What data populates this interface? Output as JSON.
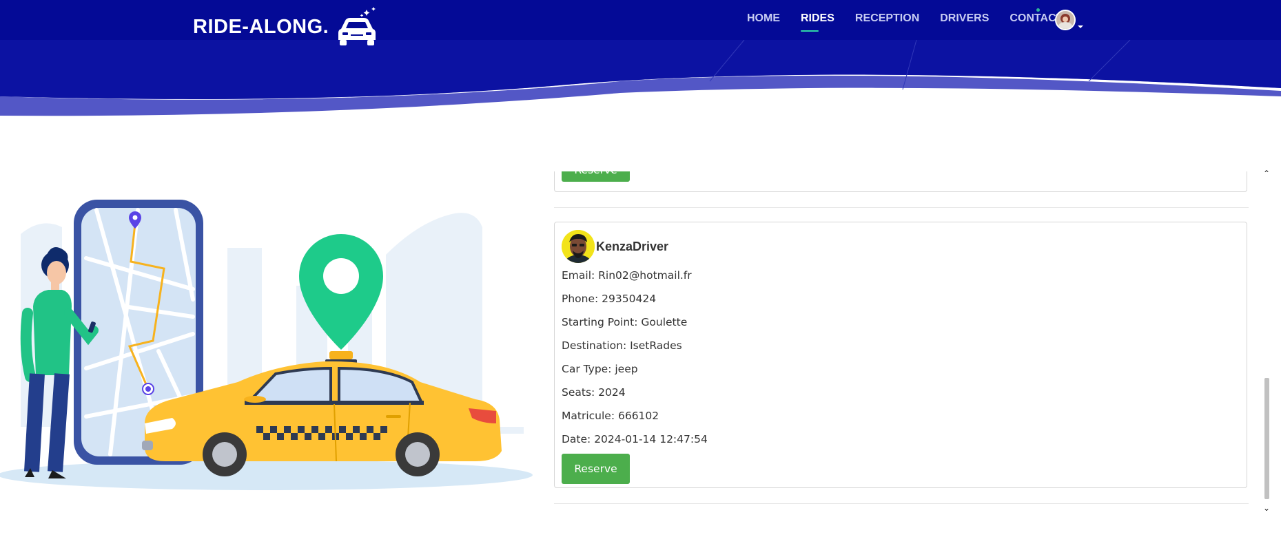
{
  "header": {
    "brand": "RIDE-ALONG.",
    "nav": [
      {
        "label": "HOME",
        "active": false
      },
      {
        "label": "RIDES",
        "active": true
      },
      {
        "label": "RECEPTION",
        "active": false
      },
      {
        "label": "DRIVERS",
        "active": false
      },
      {
        "label": "CONTACT",
        "active": false
      }
    ]
  },
  "colors": {
    "header_bg": "#040a96",
    "accent": "#2fd7a8",
    "reserve_button": "#4cae4c",
    "pin_green": "#1ecb8a",
    "taxi_yellow": "#ffc233"
  },
  "rides": {
    "previous_card": {
      "reserve_label": "Reserve"
    },
    "card": {
      "driver_name": "KenzaDriver",
      "email": "Email: Rin02@hotmail.fr",
      "phone": "Phone: 29350424",
      "starting_point": "Starting Point: Goulette",
      "destination": "Destination: IsetRades",
      "car_type": "Car Type: jeep",
      "seats": "Seats: 2024",
      "matricule": "Matricule: 666102",
      "date": "Date: 2024-01-14 12:47:54",
      "reserve_label": "Reserve"
    }
  },
  "icons": {
    "brand": "taxi-car-icon",
    "avatar": "user-avatar",
    "scroll_up": "chevron-up-icon",
    "scroll_down": "chevron-down-icon"
  }
}
